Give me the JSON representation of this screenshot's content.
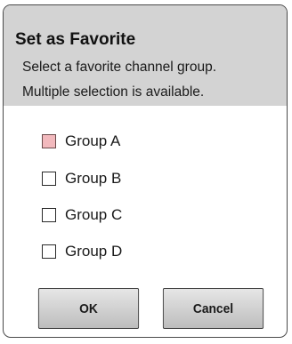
{
  "dialog": {
    "title": "Set as Favorite",
    "description_line1": "Select a favorite channel group.",
    "description_line2": "Multiple selection is available.",
    "options": [
      {
        "label": "Group A",
        "checked": false,
        "focused": true
      },
      {
        "label": "Group B",
        "checked": false,
        "focused": false
      },
      {
        "label": "Group C",
        "checked": false,
        "focused": false
      },
      {
        "label": "Group D",
        "checked": false,
        "focused": false
      }
    ],
    "ok_label": "OK",
    "cancel_label": "Cancel"
  },
  "colors": {
    "header_bg": "#d3d3d3",
    "focus_checkbox": "#f2b9bd",
    "border": "#4a4a4a"
  }
}
